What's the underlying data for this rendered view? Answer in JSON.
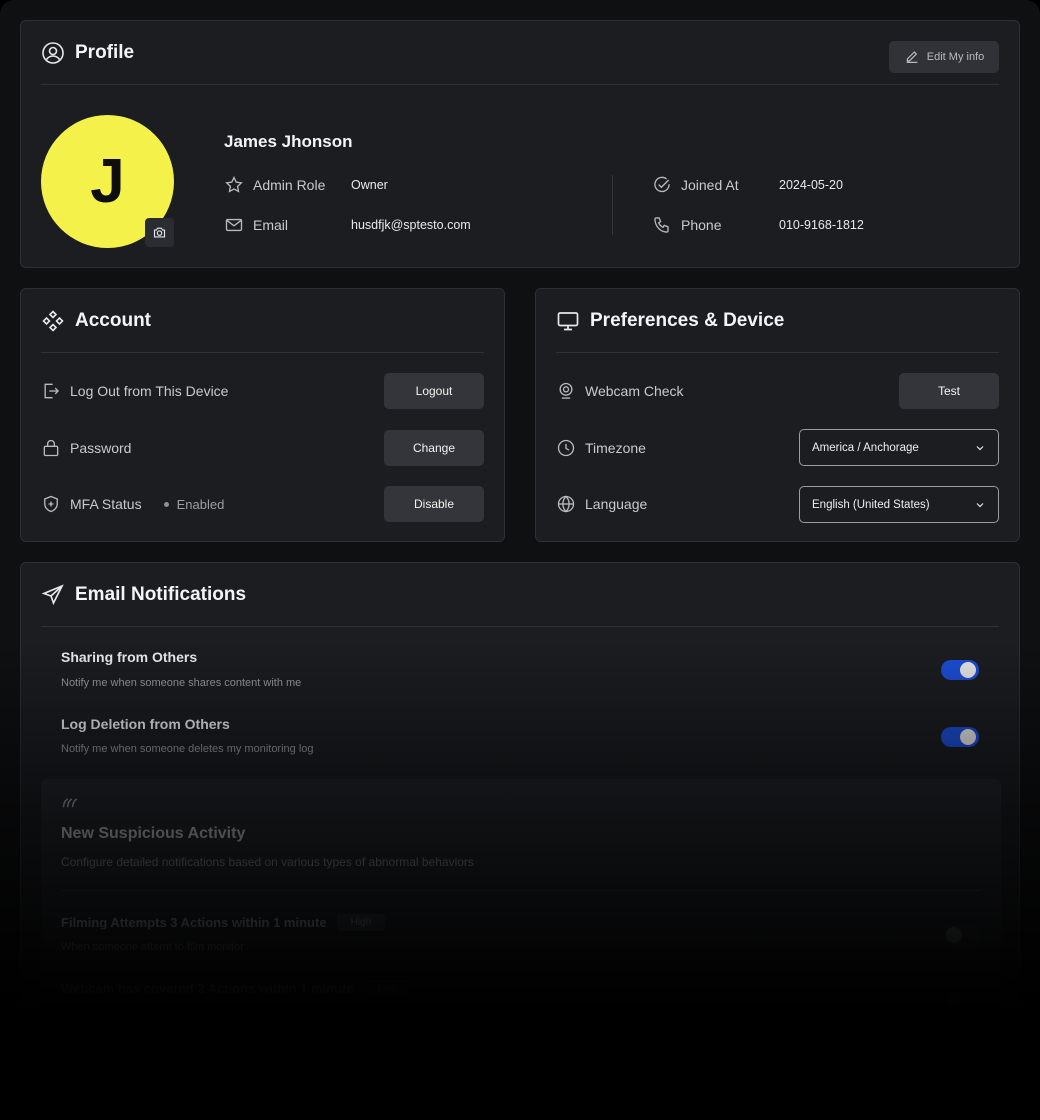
{
  "profile": {
    "title": "Profile",
    "edit_label": "Edit My info",
    "avatar_letter": "J",
    "name": "James Jhonson",
    "admin_role_label": "Admin Role",
    "admin_role_value": "Owner",
    "email_label": "Email",
    "email_value": "husdfjk@sptesto.com",
    "joined_label": "Joined At",
    "joined_value": "2024-05-20",
    "phone_label": "Phone",
    "phone_value": "010-9168-1812"
  },
  "account": {
    "title": "Account",
    "logout_row": "Log Out from This Device",
    "logout_button": "Logout",
    "password_row": "Password",
    "password_button": "Change",
    "mfa_row": "MFA Status",
    "mfa_status": "Enabled",
    "mfa_button": "Disable"
  },
  "prefs": {
    "title": "Preferences & Device",
    "webcam_row": "Webcam Check",
    "webcam_button": "Test",
    "timezone_row": "Timezone",
    "timezone_value": "America / Anchorage",
    "language_row": "Language",
    "language_value": "English (United States)"
  },
  "notifications": {
    "title": "Email Notifications",
    "items": [
      {
        "title": "Sharing from Others",
        "desc": "Notify me when someone shares content with me",
        "enabled": true
      },
      {
        "title": "Log Deletion from Others",
        "desc": "Notify me when someone deletes my monitoring log",
        "enabled": true
      }
    ],
    "suspicious": {
      "title": "New Suspicious Activity",
      "desc": "Configure detailed notifications based on various types of abnormal behaviors",
      "actions": [
        {
          "title": "Filming Attempts 3 Actions within 1 minute",
          "badge": "High",
          "desc": "When someone attemt to film monitor",
          "enabled": false
        },
        {
          "title": "Webcam has covered 2 Actions within 1 minute",
          "badge": "Low",
          "desc": "",
          "enabled": false
        }
      ]
    }
  },
  "colors": {
    "accent_yellow": "#f4f24a",
    "toggle_on": "#1d4ed8",
    "card_bg": "#1c1d21"
  }
}
